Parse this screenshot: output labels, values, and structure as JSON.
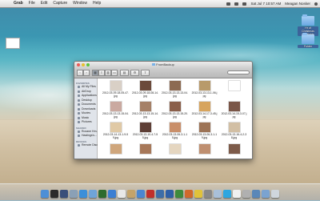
{
  "menubar": {
    "apple": "",
    "app_name": "Grab",
    "items": [
      "File",
      "Edit",
      "Capture",
      "Window",
      "Help"
    ],
    "clock": "Sat Jul 7  10:57 AM",
    "user": "Meagan Nosker"
  },
  "desktop": {
    "items": [
      {
        "label": "",
        "type": "document"
      },
      {
        "label": "Hr of Christmas Highlights",
        "type": "folder"
      },
      {
        "label": "Folder",
        "type": "folder"
      }
    ]
  },
  "finder": {
    "title": "FromBackup",
    "search_placeholder": "",
    "sidebar": {
      "favorites_header": "FAVORITES",
      "favorites": [
        {
          "label": "All My Files",
          "icon": "all-files-icon"
        },
        {
          "label": "AirDrop",
          "icon": "airdrop-icon"
        },
        {
          "label": "Applications",
          "icon": "applications-icon"
        },
        {
          "label": "Desktop",
          "icon": "desktop-icon"
        },
        {
          "label": "Documents",
          "icon": "documents-icon"
        },
        {
          "label": "Downloads",
          "icon": "downloads-icon"
        },
        {
          "label": "Movies",
          "icon": "movies-icon"
        },
        {
          "label": "Music",
          "icon": "music-icon"
        },
        {
          "label": "Pictures",
          "icon": "pictures-icon"
        }
      ],
      "shared_header": "SHARED",
      "shared": [
        {
          "label": "Roxane Hm...",
          "icon": "computer-icon"
        },
        {
          "label": "Hastings's...",
          "icon": "computer-icon"
        }
      ],
      "devices_header": "DEVICES",
      "devices": [
        {
          "label": "Remote Disc",
          "icon": "disc-icon"
        }
      ]
    },
    "files": [
      {
        "name": "2012-03-09-18-05-47.jpg",
        "color": "#d9d0c6"
      },
      {
        "name": "2012-03-09-18-08-14.jpg",
        "color": "#6b4a3b"
      },
      {
        "name": "2012-03-13-13-13-04.jpg",
        "color": "#8c6a52"
      },
      {
        "name": "2012-03-13-13-1-06.jpg",
        "color": "#b89a6a"
      },
      {
        "name": "",
        "color": "#ffffff"
      },
      {
        "name": "2012-03-13-13-15-04.jpg",
        "color": "#caa9a0"
      },
      {
        "name": "2012-03-13-13-15-14.jpg",
        "color": "#a58067"
      },
      {
        "name": "2012-03-13-13-15-20.jpg",
        "color": "#8a5f4a"
      },
      {
        "name": "2012-03-14-17-3-45.jpg",
        "color": "#d7a45d"
      },
      {
        "name": "2012-03-14-15-3-07.jpg",
        "color": "#7a5648"
      },
      {
        "name": "2012-03-14-13-1-9-59.jpg",
        "color": "#e0c9a5"
      },
      {
        "name": "2012-03-13-10-4-7-55.jpg",
        "color": "#5e3f36"
      },
      {
        "name": "2012-03-13-06-3-1-15.jpg",
        "color": "#c98f6a"
      },
      {
        "name": "2012-03-13-06-3-1-19.jpg",
        "color": "#9c7356"
      },
      {
        "name": "2012-03-13-16-4-2-38.jpg",
        "color": "#d2bfa4"
      },
      {
        "name": "",
        "color": "#cfa67c"
      },
      {
        "name": "",
        "color": "#a77859"
      },
      {
        "name": "",
        "color": "#e5d6c0"
      },
      {
        "name": "",
        "color": "#bf8f70"
      },
      {
        "name": "",
        "color": "#7d5b4a"
      }
    ]
  },
  "dock": {
    "icons": [
      {
        "name": "finder-icon",
        "color": "#4d8fd6"
      },
      {
        "name": "dashboard-icon",
        "color": "#2b2b2b"
      },
      {
        "name": "mission-control-icon",
        "color": "#3a4f7a"
      },
      {
        "name": "launchpad-icon",
        "color": "#8aa0b6"
      },
      {
        "name": "safari-icon",
        "color": "#3b8fd9"
      },
      {
        "name": "mail-icon",
        "color": "#6fa4d8"
      },
      {
        "name": "facetime-icon",
        "color": "#2e6b2e"
      },
      {
        "name": "app-store-icon",
        "color": "#3c7fd3"
      },
      {
        "name": "ical-icon",
        "color": "#e8e8e8"
      },
      {
        "name": "notes-icon",
        "color": "#c4a36a"
      },
      {
        "name": "itunes-icon",
        "color": "#4a86d1"
      },
      {
        "name": "photo-booth-icon",
        "color": "#c0302b"
      },
      {
        "name": "iphoto-icon",
        "color": "#3d6da8"
      },
      {
        "name": "word-icon",
        "color": "#2f5fa6"
      },
      {
        "name": "excel-icon",
        "color": "#3e8a3c"
      },
      {
        "name": "powerpoint-icon",
        "color": "#d0692b"
      },
      {
        "name": "chrome-icon",
        "color": "#e0c23a"
      },
      {
        "name": "system-preferences-icon",
        "color": "#888888"
      },
      {
        "name": "preview-icon",
        "color": "#a9c0d9"
      },
      {
        "name": "skype-icon",
        "color": "#2ea6e0"
      },
      {
        "name": "textedit-icon",
        "color": "#f0f0f0"
      },
      {
        "name": "grab-icon",
        "color": "#b0b0b0"
      },
      {
        "name": "downloads-stack-icon",
        "color": "#5a87b8"
      },
      {
        "name": "documents-stack-icon",
        "color": "#7ba3d0"
      },
      {
        "name": "trash-icon",
        "color": "#cfd6dd"
      }
    ]
  }
}
